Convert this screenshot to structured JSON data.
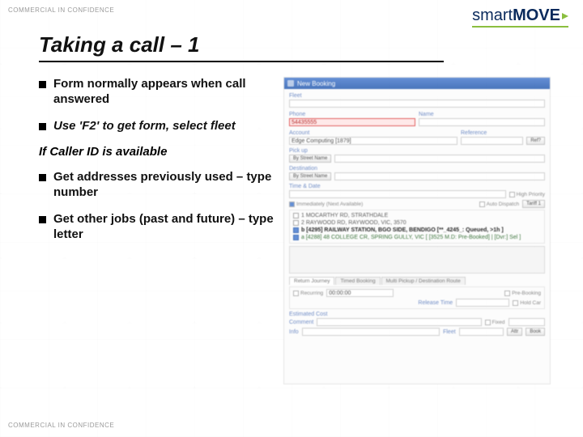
{
  "confidential": "COMMERCIAL IN CONFIDENCE",
  "logo": {
    "part1": "smart",
    "part2": "MOVE"
  },
  "title": "Taking a call – 1",
  "bullets": [
    "Form normally appears when call answered",
    "Use 'F2' to get form, select fleet"
  ],
  "subhead": "If Caller ID is available",
  "bullets2": [
    "Get addresses previously used – type number",
    "Get other jobs (past and future) – type letter"
  ],
  "form": {
    "title": "New Booking",
    "fleet_label": "Fleet",
    "phone_label": "Phone",
    "phone_value": "54435555",
    "name_label": "Name",
    "account_label": "Account",
    "account_value": "Edge Computing [1879]",
    "ref_label": "Reference",
    "ref_btn": "Ref?",
    "pickup_label": "Pick up",
    "address_mode": "By Street Name",
    "destination_label": "Destination",
    "time_label": "Time & Date",
    "immediate": "Immediately (Next Available)",
    "highpriority": "High Priority",
    "dispatch": "Auto Dispatch",
    "tariff": "Tariff 1",
    "addr_lines": [
      "1   MOCARTHY RD, STRATHDALE",
      "2   RAYWOOD RD, RAYWOOD, VIC, 3570",
      "b   [4295] RAILWAY STATION, BGO SIDE, BENDIGO [**_4245_: Queued, >1h ]",
      "a   [4288] 48 COLLEGE CR, SPRING GULLY, VIC [ [3525 M.D: Pre-Booked] | [Dvr:] Sel ]"
    ],
    "tabs": [
      "Return Journey",
      "Timed Booking",
      "Multi Pickup / Destination Route"
    ],
    "recurring": "Recurring",
    "releasetime_label": "Release Time",
    "estcost_label": "Estimated Cost",
    "prebook": "Pre-Booking",
    "holdcar": "Hold Car",
    "comment_label": "Comment",
    "fixed": "Fixed",
    "info_label": "Info",
    "fleet_combo": "Fleet",
    "attr_btn": "Attr",
    "book_btn": "Book"
  }
}
